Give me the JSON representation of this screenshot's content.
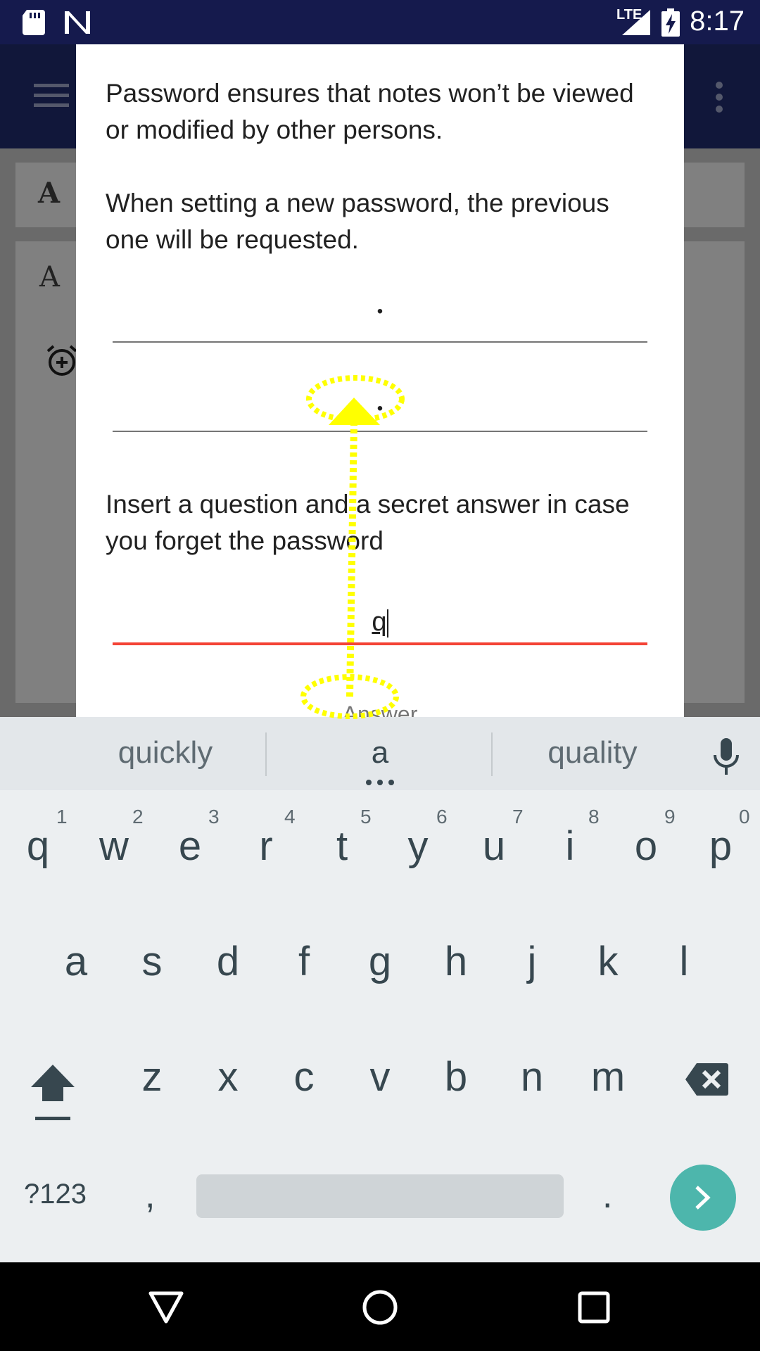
{
  "status_bar": {
    "time": "8:17",
    "network": "LTE",
    "icons": [
      "sd-card-icon",
      "n-notification-icon",
      "signal-icon",
      "battery-charging-icon"
    ]
  },
  "background": {
    "card1_letter": "A",
    "card2_letter": "A"
  },
  "dialog": {
    "paragraph1": "Password ensures that notes won’t be viewed or modified by other persons.",
    "paragraph2": "When setting a new password, the previous one will be requested.",
    "password_value": "•",
    "confirm_value": "•",
    "question_text": "Insert a question and a secret answer in case you forget the password",
    "question_value": "q",
    "answer_hint": "Answer"
  },
  "keyboard": {
    "suggestions": [
      "quickly",
      "a",
      "quality"
    ],
    "row1": [
      {
        "key": "q",
        "num": "1"
      },
      {
        "key": "w",
        "num": "2"
      },
      {
        "key": "e",
        "num": "3"
      },
      {
        "key": "r",
        "num": "4"
      },
      {
        "key": "t",
        "num": "5"
      },
      {
        "key": "y",
        "num": "6"
      },
      {
        "key": "u",
        "num": "7"
      },
      {
        "key": "i",
        "num": "8"
      },
      {
        "key": "o",
        "num": "9"
      },
      {
        "key": "p",
        "num": "0"
      }
    ],
    "row2": [
      "a",
      "s",
      "d",
      "f",
      "g",
      "h",
      "j",
      "k",
      "l"
    ],
    "row3": [
      "z",
      "x",
      "c",
      "v",
      "b",
      "n",
      "m"
    ],
    "symbols_label": "?123",
    "comma": ",",
    "period": "."
  },
  "annotation": {
    "color": "#ffff00",
    "gesture": "swipe-up"
  }
}
